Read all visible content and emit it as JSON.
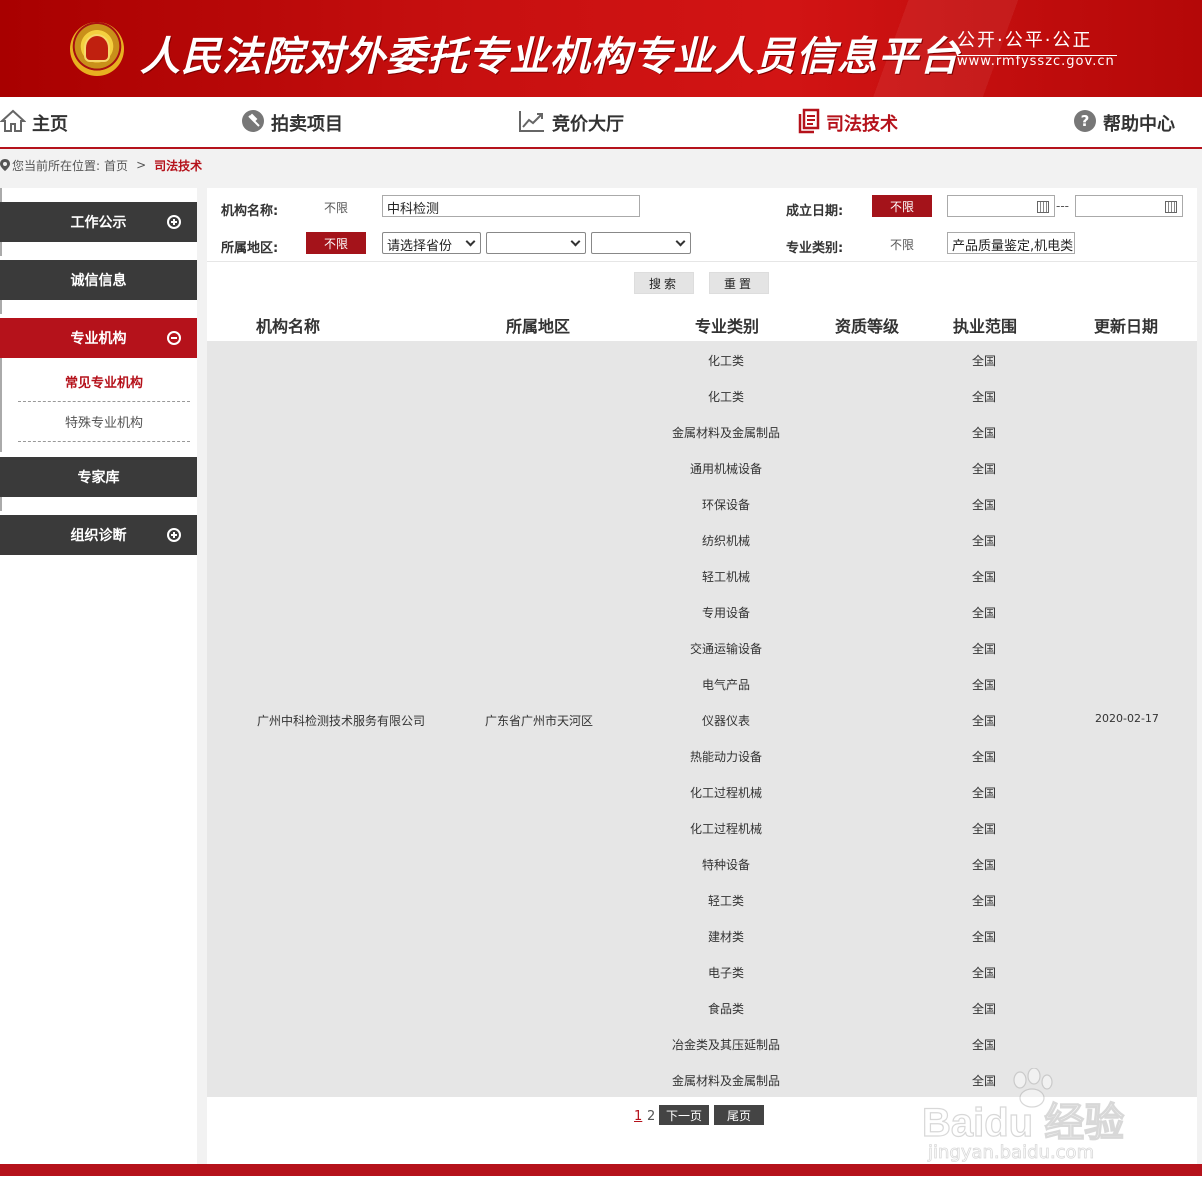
{
  "header": {
    "title": "人民法院对外委托专业机构专业人员信息平台",
    "slogan": "公开·公平·公正",
    "domain": "www.rmfysszc.gov.cn"
  },
  "nav": {
    "items": [
      {
        "label": "主页",
        "icon": "home-icon"
      },
      {
        "label": "拍卖项目",
        "icon": "gavel-icon"
      },
      {
        "label": "竞价大厅",
        "icon": "trend-chart-icon"
      },
      {
        "label": "司法技术",
        "icon": "documents-icon",
        "active": true
      },
      {
        "label": "帮助中心",
        "icon": "help-icon"
      }
    ]
  },
  "breadcrumb": {
    "prefix": "您当前所在位置:",
    "home": "首页",
    "separator": ">",
    "current": "司法技术"
  },
  "sidebar": {
    "items": [
      {
        "label": "工作公示",
        "toggle": "plus"
      },
      {
        "label": "诚信信息"
      },
      {
        "label": "专业机构",
        "toggle": "minus",
        "active": true
      },
      {
        "label": "专家库"
      },
      {
        "label": "组织诊断",
        "toggle": "plus"
      }
    ],
    "subitems": [
      {
        "label": "常见专业机构",
        "active": true
      },
      {
        "label": "特殊专业机构"
      }
    ]
  },
  "filters": {
    "org_name_label": "机构名称:",
    "org_name_any": "不限",
    "org_name_value": "中科检测",
    "founded_label": "成立日期:",
    "founded_any": "不限",
    "date_separator": "---",
    "region_label": "所属地区:",
    "region_any": "不限",
    "province_select": "请选择省份",
    "city_select": "",
    "district_select": "",
    "category_label": "专业类别:",
    "category_any": "不限",
    "category_value": "产品质量鉴定,机电类"
  },
  "buttons": {
    "search": "搜索",
    "reset": "重置"
  },
  "table": {
    "headers": [
      "机构名称",
      "所属地区",
      "专业类别",
      "资质等级",
      "执业范围",
      "更新日期"
    ],
    "org_name": "广州中科检测技术服务有限公司",
    "region": "广东省广州市天河区",
    "qualification": "",
    "updated": "2020-02-17",
    "rows": [
      {
        "major": "化工类",
        "scope": "全国"
      },
      {
        "major": "化工类",
        "scope": "全国"
      },
      {
        "major": "金属材料及金属制品",
        "scope": "全国"
      },
      {
        "major": "通用机械设备",
        "scope": "全国"
      },
      {
        "major": "环保设备",
        "scope": "全国"
      },
      {
        "major": "纺织机械",
        "scope": "全国"
      },
      {
        "major": "轻工机械",
        "scope": "全国"
      },
      {
        "major": "专用设备",
        "scope": "全国"
      },
      {
        "major": "交通运输设备",
        "scope": "全国"
      },
      {
        "major": "电气产品",
        "scope": "全国"
      },
      {
        "major": "仪器仪表",
        "scope": "全国"
      },
      {
        "major": "热能动力设备",
        "scope": "全国"
      },
      {
        "major": "化工过程机械",
        "scope": "全国"
      },
      {
        "major": "化工过程机械",
        "scope": "全国"
      },
      {
        "major": "特种设备",
        "scope": "全国"
      },
      {
        "major": "轻工类",
        "scope": "全国"
      },
      {
        "major": "建材类",
        "scope": "全国"
      },
      {
        "major": "电子类",
        "scope": "全国"
      },
      {
        "major": "食品类",
        "scope": "全国"
      },
      {
        "major": "冶金类及其压延制品",
        "scope": "全国"
      },
      {
        "major": "金属材料及金属制品",
        "scope": "全国"
      }
    ]
  },
  "pagination": {
    "pages": [
      "1",
      "2"
    ],
    "current": "1",
    "next": "下一页",
    "last": "尾页"
  },
  "watermark": {
    "main": "Baidu 经验",
    "sub": "jingyan.baidu.com"
  },
  "colors": {
    "brand_red": "#b5121b",
    "menu_dark": "#3a3a3a",
    "table_bg": "#e6e6e6"
  }
}
